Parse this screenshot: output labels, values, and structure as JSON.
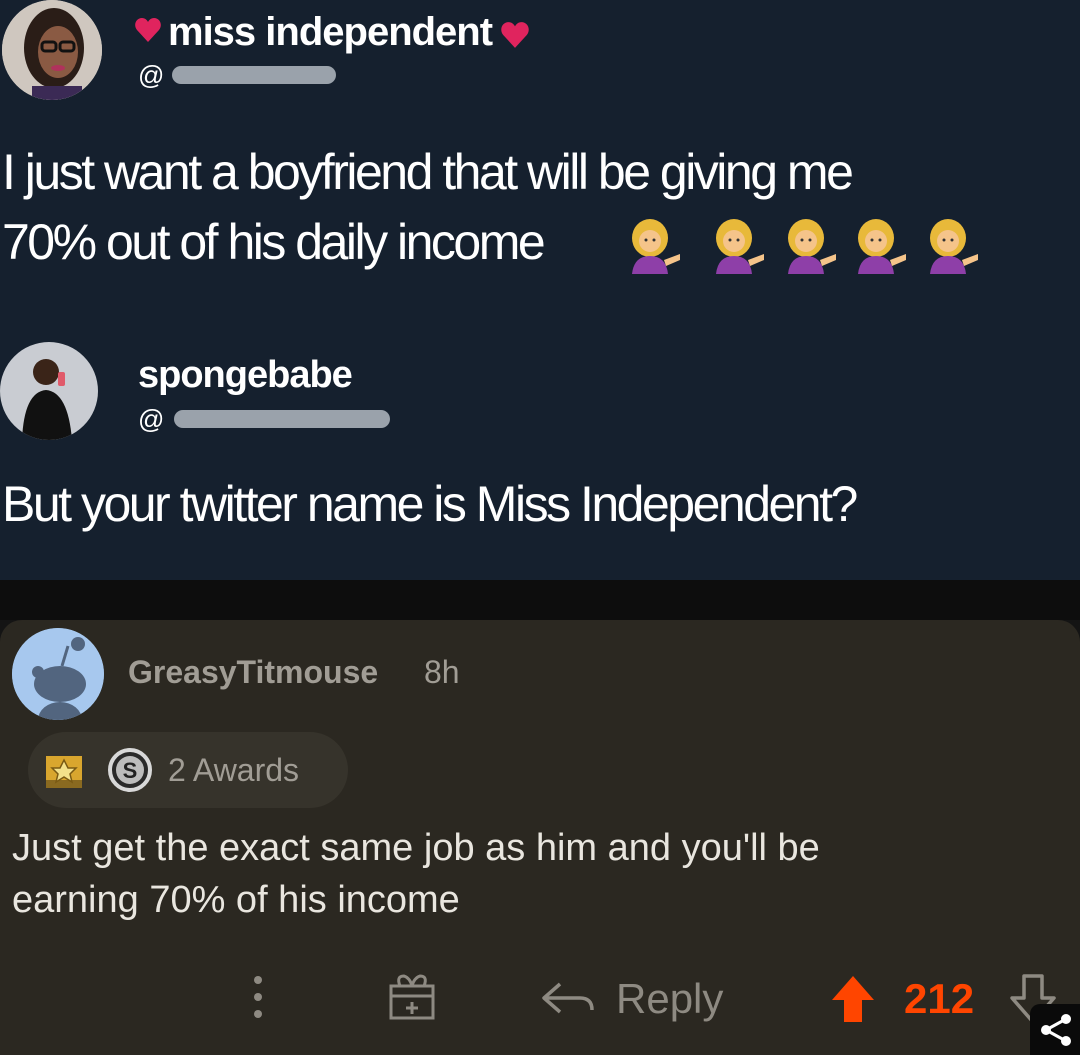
{
  "tweet1": {
    "name": "miss independent",
    "at": "@",
    "text_line1": "I just want a boyfriend that will be giving me",
    "text_line2": "70% out of his daily income",
    "emoji_count": 5
  },
  "tweet2": {
    "name": "spongebabe",
    "at": "@",
    "text": "But your twitter name is Miss Independent?"
  },
  "comment": {
    "username": "GreasyTitmouse",
    "age": "8h",
    "awards_label": "2 Awards",
    "award_coin_letter": "S",
    "body_line1": "Just get the exact same job as him and you'll be",
    "body_line2": "earning 70% of his income",
    "reply_label": "Reply",
    "score": "212"
  },
  "colors": {
    "twitter_bg": "#15202e",
    "reddit_card_bg": "#2b2821",
    "upvote_orange": "#ff4500",
    "heart_red": "#e0245e"
  },
  "icons": [
    "heart-icon",
    "person-tipping-hand-emoji",
    "snoo-avatar",
    "silver-award-icon",
    "gold-award-icon",
    "more-options-icon",
    "gift-icon",
    "reply-arrow-icon",
    "upvote-arrow-icon",
    "downvote-arrow-icon",
    "share-icon"
  ]
}
